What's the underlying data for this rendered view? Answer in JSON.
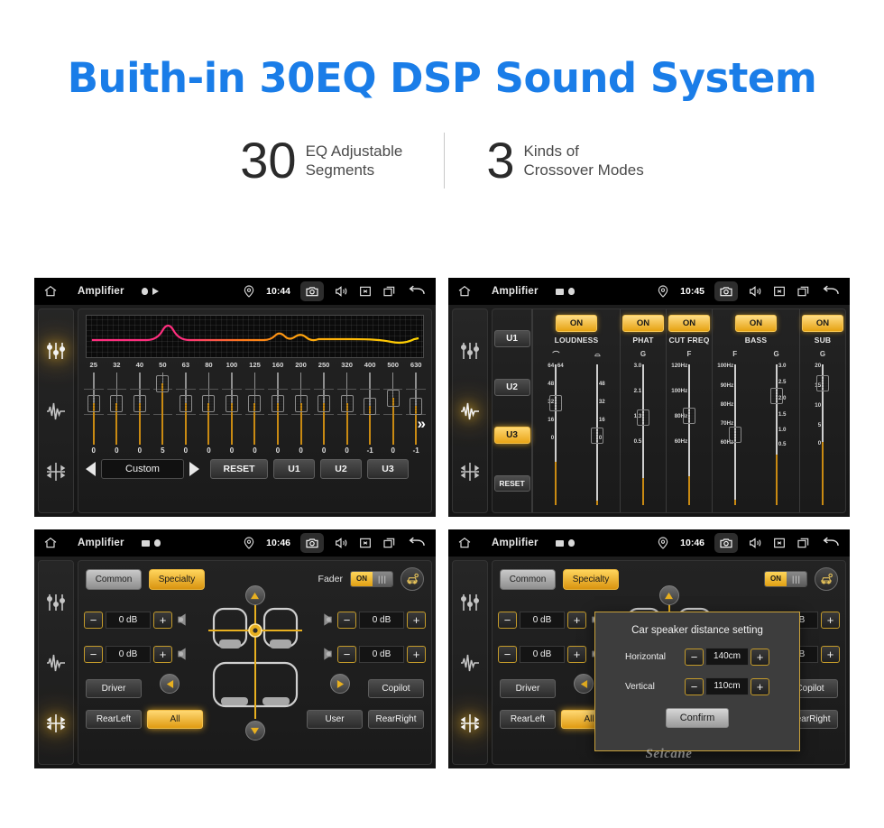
{
  "header": {
    "title": "Buith-in 30EQ DSP Sound System",
    "title_color": "#1a7de8",
    "stats": [
      {
        "number": "30",
        "line1": "EQ Adjustable",
        "line2": "Segments"
      },
      {
        "number": "3",
        "line1": "Kinds of",
        "line2": "Crossover Modes"
      }
    ]
  },
  "statusbar": {
    "app_title": "Amplifier",
    "times": {
      "p1": "10:44",
      "p2": "10:45",
      "p3": "10:46",
      "p4": "10:46"
    },
    "icons": [
      "home-icon",
      "location-pin-icon",
      "camera-icon",
      "volume-icon",
      "close-box-icon",
      "recent-apps-icon",
      "back-arrow-icon"
    ]
  },
  "rail": {
    "icons": [
      "equalizer-sliders-icon",
      "waveform-icon",
      "balance-fader-icon"
    ],
    "active": {
      "p1": 0,
      "p2": 1,
      "p3": 2,
      "p4": 2
    }
  },
  "panel_eq": {
    "bands": [
      "25",
      "32",
      "40",
      "50",
      "63",
      "80",
      "100",
      "125",
      "160",
      "200",
      "250",
      "320",
      "400",
      "500",
      "630"
    ],
    "values": [
      "0",
      "0",
      "0",
      "5",
      "0",
      "0",
      "0",
      "0",
      "0",
      "0",
      "0",
      "0",
      "-1",
      "0",
      "-1"
    ],
    "preset_label": "Custom",
    "reset_label": "RESET",
    "user_presets": [
      "U1",
      "U2",
      "U3"
    ],
    "more_glyph": "»",
    "curve_colors": [
      "#ff2e7e",
      "#ff7a1a",
      "#ffd400"
    ]
  },
  "panel_xover": {
    "presets": [
      "U1",
      "U2",
      "U3"
    ],
    "preset_selected": "U3",
    "reset_label": "RESET",
    "columns": [
      {
        "name": "LOUDNESS",
        "state": "ON",
        "sub_labels": [
          "⌒",
          "⌓"
        ],
        "sliders": [
          {
            "ticks": [
              "64",
              "48",
              "32",
              "16",
              "0"
            ],
            "value_pct": 50
          },
          {
            "ticks": [
              "64",
              "48",
              "32",
              "16",
              "0"
            ],
            "value_pct": 5
          }
        ]
      },
      {
        "name": "PHAT",
        "state": "ON",
        "sub_labels": [
          "G"
        ],
        "sliders": [
          {
            "ticks": [
              "3.0",
              "2.1",
              "1.3",
              "0.5"
            ],
            "value_pct": 32
          }
        ]
      },
      {
        "name": "CUT FREQ",
        "state": "ON",
        "sub_labels": [
          "F"
        ],
        "sliders": [
          {
            "ticks": [
              "120Hz",
              "100Hz",
              "80Hz",
              "60Hz"
            ],
            "value_pct": 36
          }
        ]
      },
      {
        "name": "BASS",
        "state": "ON",
        "sub_labels": [
          "F",
          "G"
        ],
        "sliders": [
          {
            "ticks": [
              "100Hz",
              "90Hz",
              "80Hz",
              "70Hz",
              "60Hz"
            ],
            "value_pct": 6
          },
          {
            "ticks": [
              "3.0",
              "2.5",
              "2.0",
              "1.5",
              "1.0",
              "0.5"
            ],
            "value_pct": 58
          }
        ]
      },
      {
        "name": "SUB",
        "state": "ON",
        "sub_labels": [
          "G"
        ],
        "sliders": [
          {
            "ticks": [
              "20",
              "15",
              "10",
              "5",
              "0"
            ],
            "value_pct": 74
          }
        ]
      }
    ]
  },
  "panel_fader": {
    "tabs": [
      {
        "label": "Common",
        "selected": false
      },
      {
        "label": "Specialty",
        "selected": true
      }
    ],
    "fader_label": "Fader",
    "toggle_state": "ON",
    "distance_icon": "car-distance-icon",
    "speakers": [
      {
        "position": "front-left",
        "value": "0 dB",
        "minus": "−",
        "plus": "+"
      },
      {
        "position": "rear-left",
        "value": "0 dB",
        "minus": "−",
        "plus": "+"
      },
      {
        "position": "front-right",
        "value": "0 dB",
        "minus": "−",
        "plus": "+"
      },
      {
        "position": "rear-right",
        "value": "0 dB",
        "minus": "−",
        "plus": "+"
      }
    ],
    "position_buttons": [
      {
        "label": "Driver",
        "selected": false
      },
      {
        "label": "Copilot",
        "selected": false
      },
      {
        "label": "RearLeft",
        "selected": false
      },
      {
        "label": "All",
        "selected": true
      },
      {
        "label": "User",
        "selected": false
      },
      {
        "label": "RearRight",
        "selected": false
      }
    ],
    "nav_icons": [
      "nav-up-icon",
      "nav-down-icon",
      "nav-left-icon",
      "nav-right-icon"
    ]
  },
  "dialog": {
    "title": "Car speaker distance setting",
    "rows": [
      {
        "label": "Horizontal",
        "value": "140cm",
        "minus": "−",
        "plus": "+"
      },
      {
        "label": "Vertical",
        "value": "110cm",
        "minus": "−",
        "plus": "+"
      }
    ],
    "confirm_label": "Confirm"
  },
  "watermark": {
    "text": "Seicane"
  }
}
